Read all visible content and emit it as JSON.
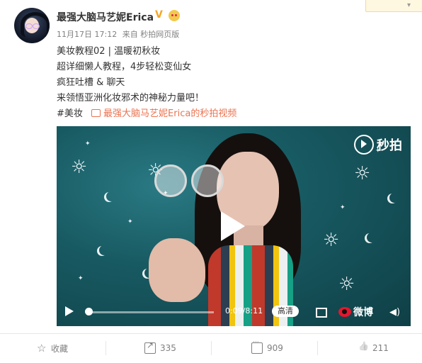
{
  "post": {
    "user_name": "最强大脑马艺妮Erica",
    "verified_mark": "V",
    "time": "11月17日 17:12",
    "source": "来自 秒拍网页版",
    "lines": [
      "美妆教程02 | 温暖初秋妆",
      "超详细懒人教程，4步轻松变仙女",
      "疯狂吐槽 & 聊天",
      "来领悟亚洲化妆邪术的神秘力量吧！"
    ],
    "tag": "#美妆",
    "video_link_text": "最强大脑马艺妮Erica的秒拍视频"
  },
  "video": {
    "brand": "秒拍",
    "time_display": "0:09/8:11",
    "progress": 0.018,
    "quality": "高清",
    "weibo_brand": "微博"
  },
  "actions": {
    "favorite_label": "收藏",
    "share_count": "335",
    "comment_count": "909",
    "like_count": "211"
  },
  "colors": {
    "link": "#eb7350",
    "video_bg": "#16535c"
  },
  "icons": [
    "favorite-icon",
    "share-icon",
    "comment-icon",
    "like-icon",
    "play-icon",
    "fullscreen-icon",
    "volume-icon"
  ]
}
